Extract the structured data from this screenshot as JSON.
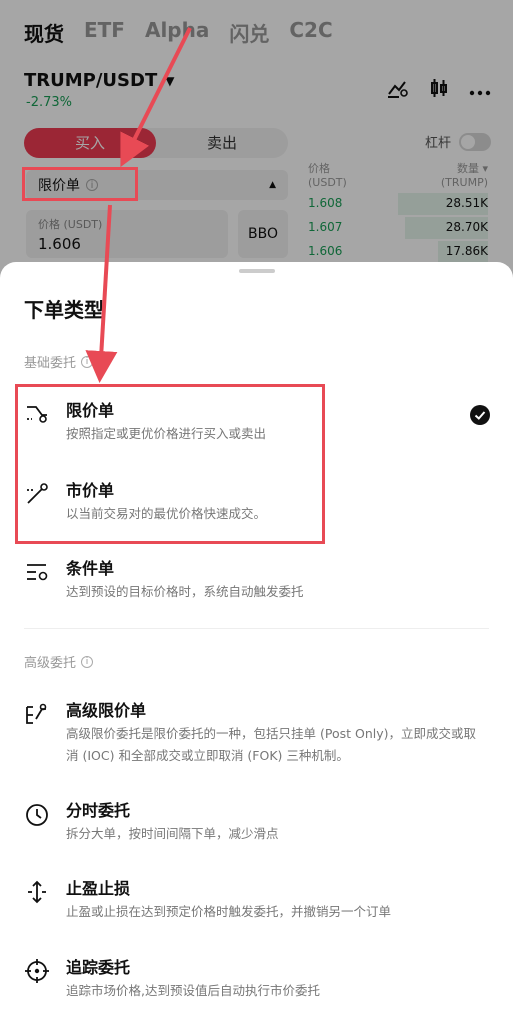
{
  "tabs": [
    "现货",
    "ETF",
    "Alpha",
    "闪兑",
    "C2C"
  ],
  "pair": "TRUMP/USDT",
  "change": "-2.73%",
  "buy_label": "买入",
  "sell_label": "卖出",
  "leverage_label": "杠杆",
  "current_order_type": "限价单",
  "price_input": {
    "label": "价格 (USDT)",
    "value": "1.606"
  },
  "bbo_label": "BBO",
  "orderbook": {
    "price_header": "价格\n(USDT)",
    "qty_header": "数量 ▾\n(TRUMP)",
    "rows": [
      {
        "price": "1.608",
        "qty": "28.51K",
        "depth": 0.5
      },
      {
        "price": "1.607",
        "qty": "28.70K",
        "depth": 0.46
      },
      {
        "price": "1.606",
        "qty": "17.86K",
        "depth": 0.28
      }
    ]
  },
  "sheet": {
    "title": "下单类型",
    "basic_section": "基础委托",
    "advanced_section": "高级委托",
    "options": [
      {
        "title": "限价单",
        "desc": "按照指定或更优价格进行买入或卖出",
        "icon": "limit-order-icon",
        "selected": true
      },
      {
        "title": "市价单",
        "desc": "以当前交易对的最优价格快速成交。",
        "icon": "market-order-icon"
      },
      {
        "title": "条件单",
        "desc": "达到预设的目标价格时，系统自动触发委托",
        "icon": "conditional-order-icon"
      },
      {
        "title": "高级限价单",
        "desc": "高级限价委托是限价委托的一种，包括只挂单 (Post Only)，立即成交或取消 (IOC) 和全部成交或立即取消 (FOK) 三种机制。",
        "icon": "advanced-limit-icon"
      },
      {
        "title": "分时委托",
        "desc": "拆分大单，按时间间隔下单，减少滑点",
        "icon": "clock-icon"
      },
      {
        "title": "止盈止损",
        "desc": "止盈或止损在达到预定价格时触发委托，并撤销另一个订单",
        "icon": "take-profit-stop-loss-icon"
      },
      {
        "title": "追踪委托",
        "desc": "追踪市场价格,达到预设值后自动执行市价委托",
        "icon": "trailing-order-icon"
      }
    ]
  },
  "colors": {
    "accent_red": "#ee3b52",
    "green": "#1a9e57",
    "annotation_red": "#e84a55"
  }
}
